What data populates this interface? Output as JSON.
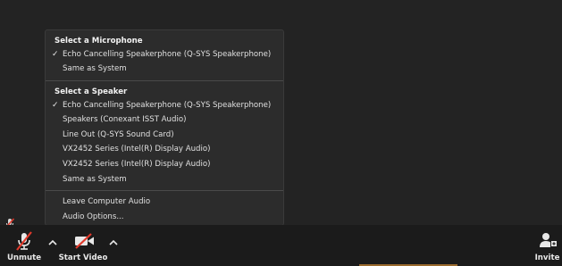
{
  "audio_menu": {
    "microphone": {
      "title": "Select a Microphone",
      "items": [
        {
          "label": "Echo Cancelling Speakerphone (Q-SYS Speakerphone)",
          "checked": true
        },
        {
          "label": "Same as System",
          "checked": false
        }
      ]
    },
    "speaker": {
      "title": "Select a Speaker",
      "items": [
        {
          "label": "Echo Cancelling Speakerphone (Q-SYS Speakerphone)",
          "checked": true
        },
        {
          "label": "Speakers (Conexant ISST Audio)",
          "checked": false
        },
        {
          "label": "Line Out (Q-SYS Sound Card)",
          "checked": false
        },
        {
          "label": "VX2452 Series (Intel(R) Display Audio)",
          "checked": false
        },
        {
          "label": "VX2452 Series (Intel(R) Display Audio)",
          "checked": false
        },
        {
          "label": "Same as System",
          "checked": false
        }
      ]
    },
    "actions": [
      {
        "label": "Leave Computer Audio"
      },
      {
        "label": "Audio Options..."
      }
    ],
    "check_glyph": "✓"
  },
  "toolbar": {
    "unmute_label": "Unmute",
    "start_video_label": "Start Video",
    "invite_label": "Invite"
  },
  "icons": {
    "unmute": "microphone-muted-icon",
    "video": "video-off-icon",
    "invite": "add-participant-icon",
    "caret": "chevron-up-icon"
  },
  "colors": {
    "background": "#232323",
    "menu_background": "#2c2c2c",
    "toolbar_background": "#1b1b1b",
    "mute_slash": "#e0392b",
    "text": "#e4e4e4"
  }
}
